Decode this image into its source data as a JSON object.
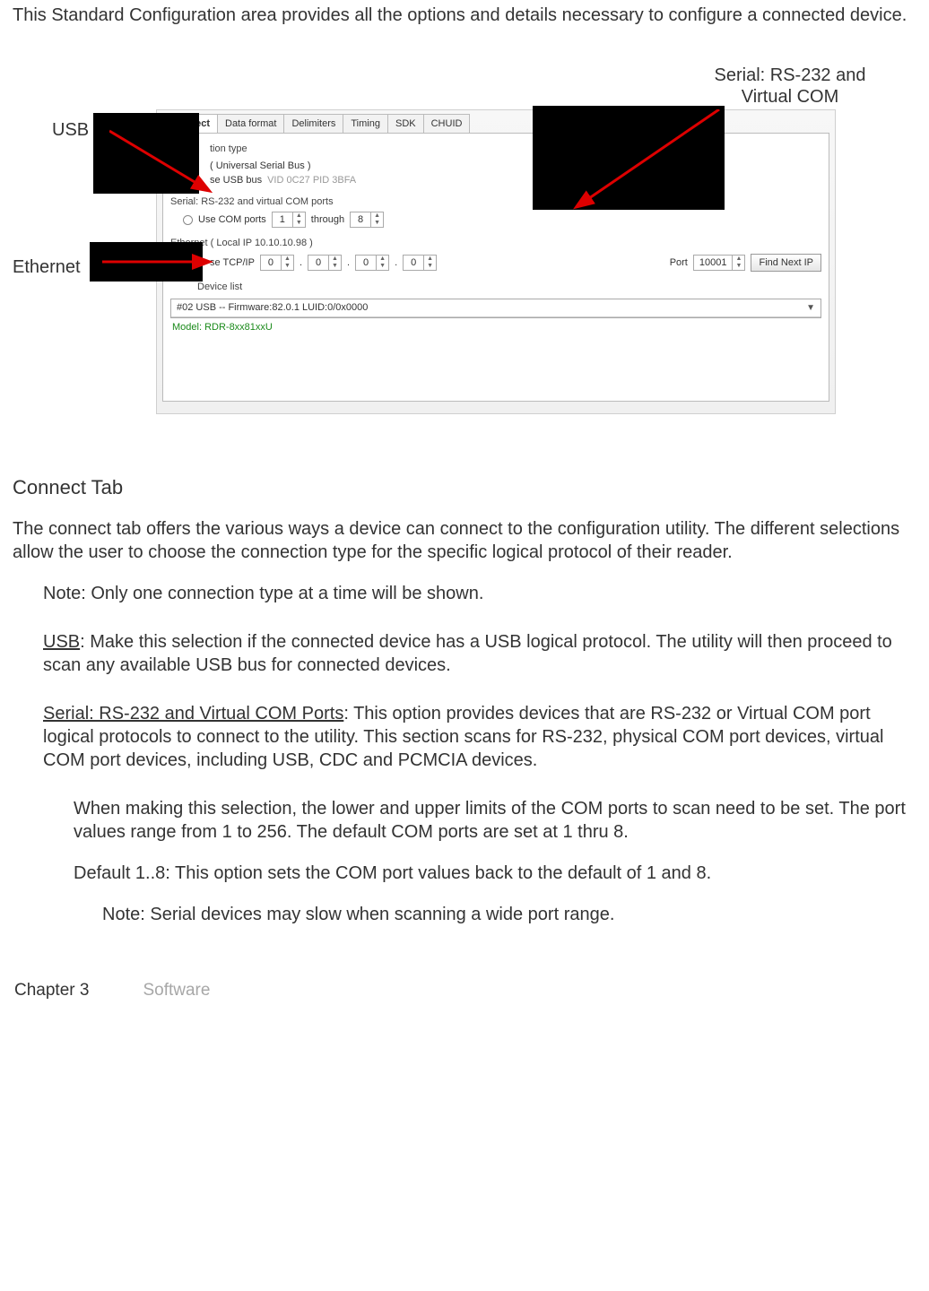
{
  "intro": "This Standard Configuration area provides all the options and details necessary to configure a connected device.",
  "callouts": {
    "usb": "USB",
    "serial": "Serial: RS-232 and Virtual COM",
    "ethernet": "Ethernet"
  },
  "panel": {
    "tabs": [
      "Connect",
      "Data format",
      "Delimiters",
      "Timing",
      "SDK",
      "CHUID"
    ],
    "activeTab": 0,
    "usb": {
      "group": "tion type",
      "lineA": "( Universal Serial Bus )",
      "lineB_prefix": "se USB bus",
      "lineB_faded": "VID 0C27  PID 3BFA"
    },
    "serial": {
      "group": "Serial: RS-232 and virtual COM ports",
      "radio_label": "Use COM ports",
      "from": "1",
      "through_label": "through",
      "to": "8"
    },
    "eth": {
      "group": "Ethernet ( Local IP 10.10.10.98 )",
      "label": "se TCP/IP",
      "ip": [
        "0",
        "0",
        "0",
        "0"
      ],
      "dot": ".",
      "port_label": "Port",
      "port": "10001",
      "find": "Find Next IP"
    },
    "device": {
      "group": "Device list",
      "selected": "#02 USB -- Firmware:82.0.1 LUID:0/0x0000",
      "model": "Model: RDR-8xx81xxU"
    }
  },
  "section": {
    "title": "Connect Tab",
    "p1": "The connect tab offers the various ways a device can connect to the configuration utility. The different selections allow the user to choose the connection type for the specific logical protocol of their reader.",
    "note1": "Note: Only one connection type at a time will be shown.",
    "usb_u": "USB",
    "usb_rest": ": Make this selection if the connected device has a USB logical protocol. The utility will then proceed to scan any available USB bus for connected devices.",
    "ser_u": "Serial: RS-232 and Virtual COM Ports",
    "ser_rest": ": This option provides devices that are RS-232 or Virtual COM port logical protocols to connect to the utility. This section scans for RS-232, physical COM port devices, virtual COM port devices, including USB, CDC and PCMCIA devices.",
    "ser_sub1": "When making this selection, the lower and upper limits of the COM ports to scan need to be set. The port values range from 1 to 256. The default COM ports are set at 1 thru 8.",
    "ser_sub2": "Default 1..8: This option sets the COM port values back to the default of 1 and  8.",
    "ser_note": "Note: Serial devices may slow when scanning a wide port range."
  },
  "footer": {
    "chapter": "Chapter 3",
    "sw": "Software"
  }
}
